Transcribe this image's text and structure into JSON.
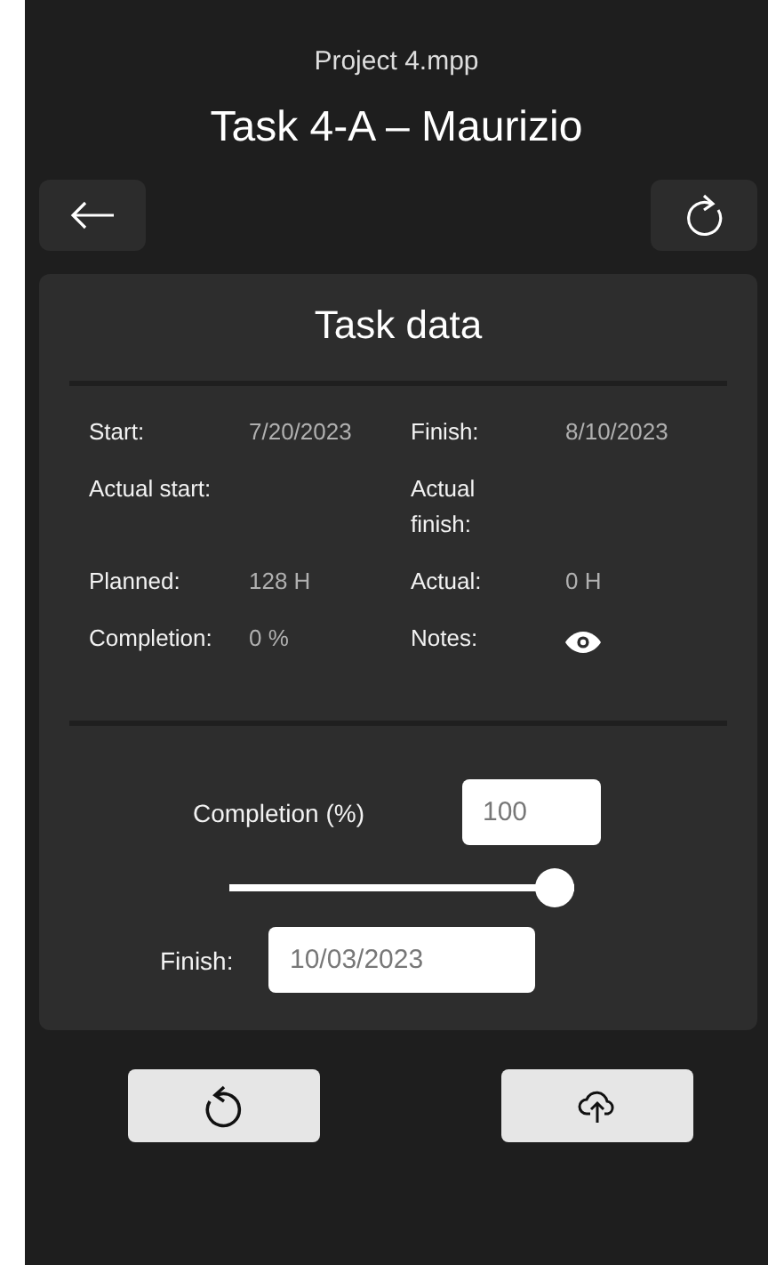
{
  "file_name": "Project 4.mpp",
  "title": "Task 4-A – Maurizio",
  "card": {
    "title": "Task data",
    "fields": [
      {
        "kind": "text",
        "label": "Start:",
        "value": "7/20/2023"
      },
      {
        "kind": "text",
        "label": "Finish:",
        "value": "8/10/2023"
      },
      {
        "kind": "text",
        "label": "Actual start:"
      },
      {
        "kind": "text",
        "label": "Actual finish:"
      },
      {
        "kind": "text",
        "label": "Planned:",
        "value": "128 H"
      },
      {
        "kind": "text",
        "label": "Actual:",
        "value": "0 H"
      },
      {
        "kind": "text",
        "label": "Completion:",
        "value": "0 %"
      },
      {
        "kind": "icon",
        "label": "Notes:"
      }
    ]
  },
  "editor": {
    "completion_label": "Completion (%)",
    "completion_value": "100",
    "slider": {
      "level": 1
    },
    "finish_label": "Finish:",
    "finish_value": "10/03/2023"
  }
}
